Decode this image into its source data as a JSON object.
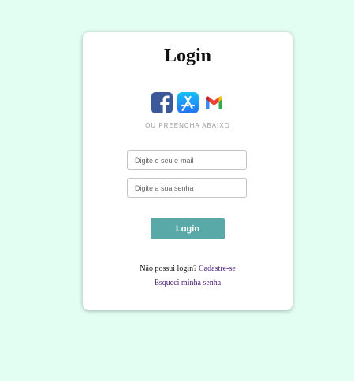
{
  "login": {
    "title": "Login",
    "social": [
      {
        "icon": "facebook-icon",
        "color": "#3b5998"
      },
      {
        "icon": "app-store-icon",
        "color": "#1a8cff"
      },
      {
        "icon": "gmail-icon",
        "color": "#ea4335"
      }
    ],
    "divider": "OU PREENCHA ABAIXO",
    "email": {
      "placeholder": "Digite o seu e-mail",
      "value": ""
    },
    "password": {
      "placeholder": "Digite a sua senha",
      "value": ""
    },
    "submit_label": "Login",
    "signup_prompt": "Não possui login? ",
    "signup_link": "Cadastre-se",
    "forgot_link": "Esqueci minha senha"
  },
  "colors": {
    "background": "#e2fdf2",
    "button": "#58a9a8",
    "link": "#4a1a78"
  }
}
